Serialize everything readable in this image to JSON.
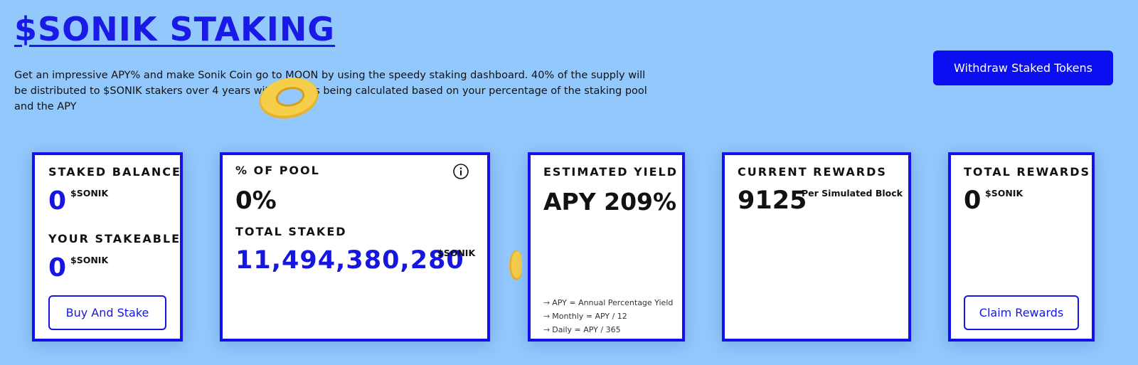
{
  "header": {
    "title": "$SONIK STAKING",
    "description": "Get an impressive APY% and make Sonik Coin go to MOON by using the speedy staking dashboard. 40% of the supply will be distributed to $SONIK stakers over 4 years with rewards being calculated based on your percentage of the staking pool and the APY",
    "withdraw_label": "Withdraw Staked Tokens"
  },
  "cards": {
    "staked": {
      "label": "STAKED BALANCE",
      "value": "0",
      "unit": "$SONIK",
      "stakeable_label": "YOUR STAKEABLE",
      "stakeable_value": "0",
      "stakeable_unit": "$SONIK",
      "button_label": "Buy And Stake"
    },
    "pool": {
      "label": "% OF POOL",
      "value": "0%",
      "total_label": "TOTAL STAKED",
      "total_value": "11,494,380,280",
      "total_unit": "$SONIK",
      "info_icon": "info-icon"
    },
    "yield": {
      "label": "ESTIMATED YIELD",
      "value": "APY 209%",
      "notes": [
        "APY = Annual Percentage Yield",
        "Monthly = APY / 12",
        "Daily = APY / 365"
      ]
    },
    "current": {
      "label": "CURRENT REWARDS",
      "value": "9125",
      "unit": "Per Simulated Block"
    },
    "total": {
      "label": "TOTAL REWARDS",
      "value": "0",
      "unit": "$SONIK",
      "button_label": "Claim Rewards"
    }
  },
  "colors": {
    "background": "#93c8fc",
    "accent": "#1616e0",
    "button": "#0a0ef0",
    "coin": "#f2c33c"
  }
}
